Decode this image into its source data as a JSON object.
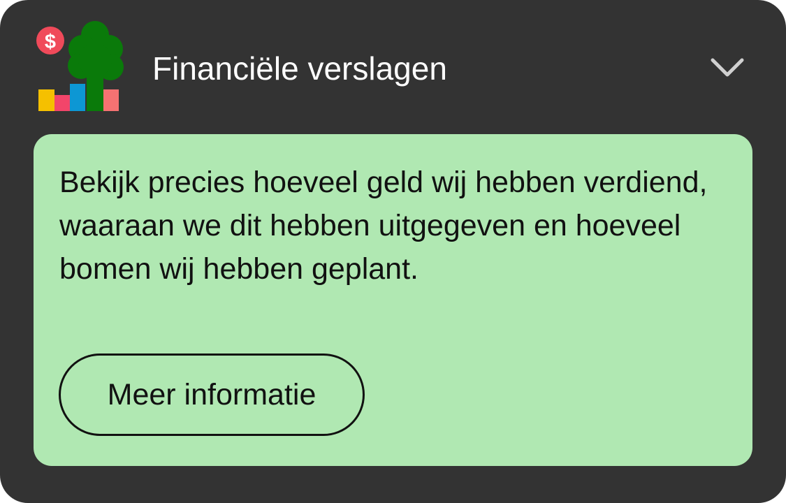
{
  "card": {
    "title": "Financiële verslagen",
    "logo_icon": "finance-tree-chart-icon",
    "toggle_icon": "chevron-down-icon",
    "description": "Bekijk precies hoeveel geld wij hebben verdiend, waaraan we dit hebben uitgegeven en hoeveel bomen wij hebben geplant.",
    "button_label": "Meer informatie"
  },
  "colors": {
    "card_background": "#333333",
    "panel_background": "#b0e8b2",
    "title_text": "#ffffff",
    "body_text": "#111111",
    "tree_green": "#0a7a0a",
    "coin_red": "#f04a5a",
    "bar_yellow": "#f5c000",
    "bar_pink": "#f2456a",
    "bar_blue": "#0d97d4",
    "bar_salmon": "#f57272"
  }
}
